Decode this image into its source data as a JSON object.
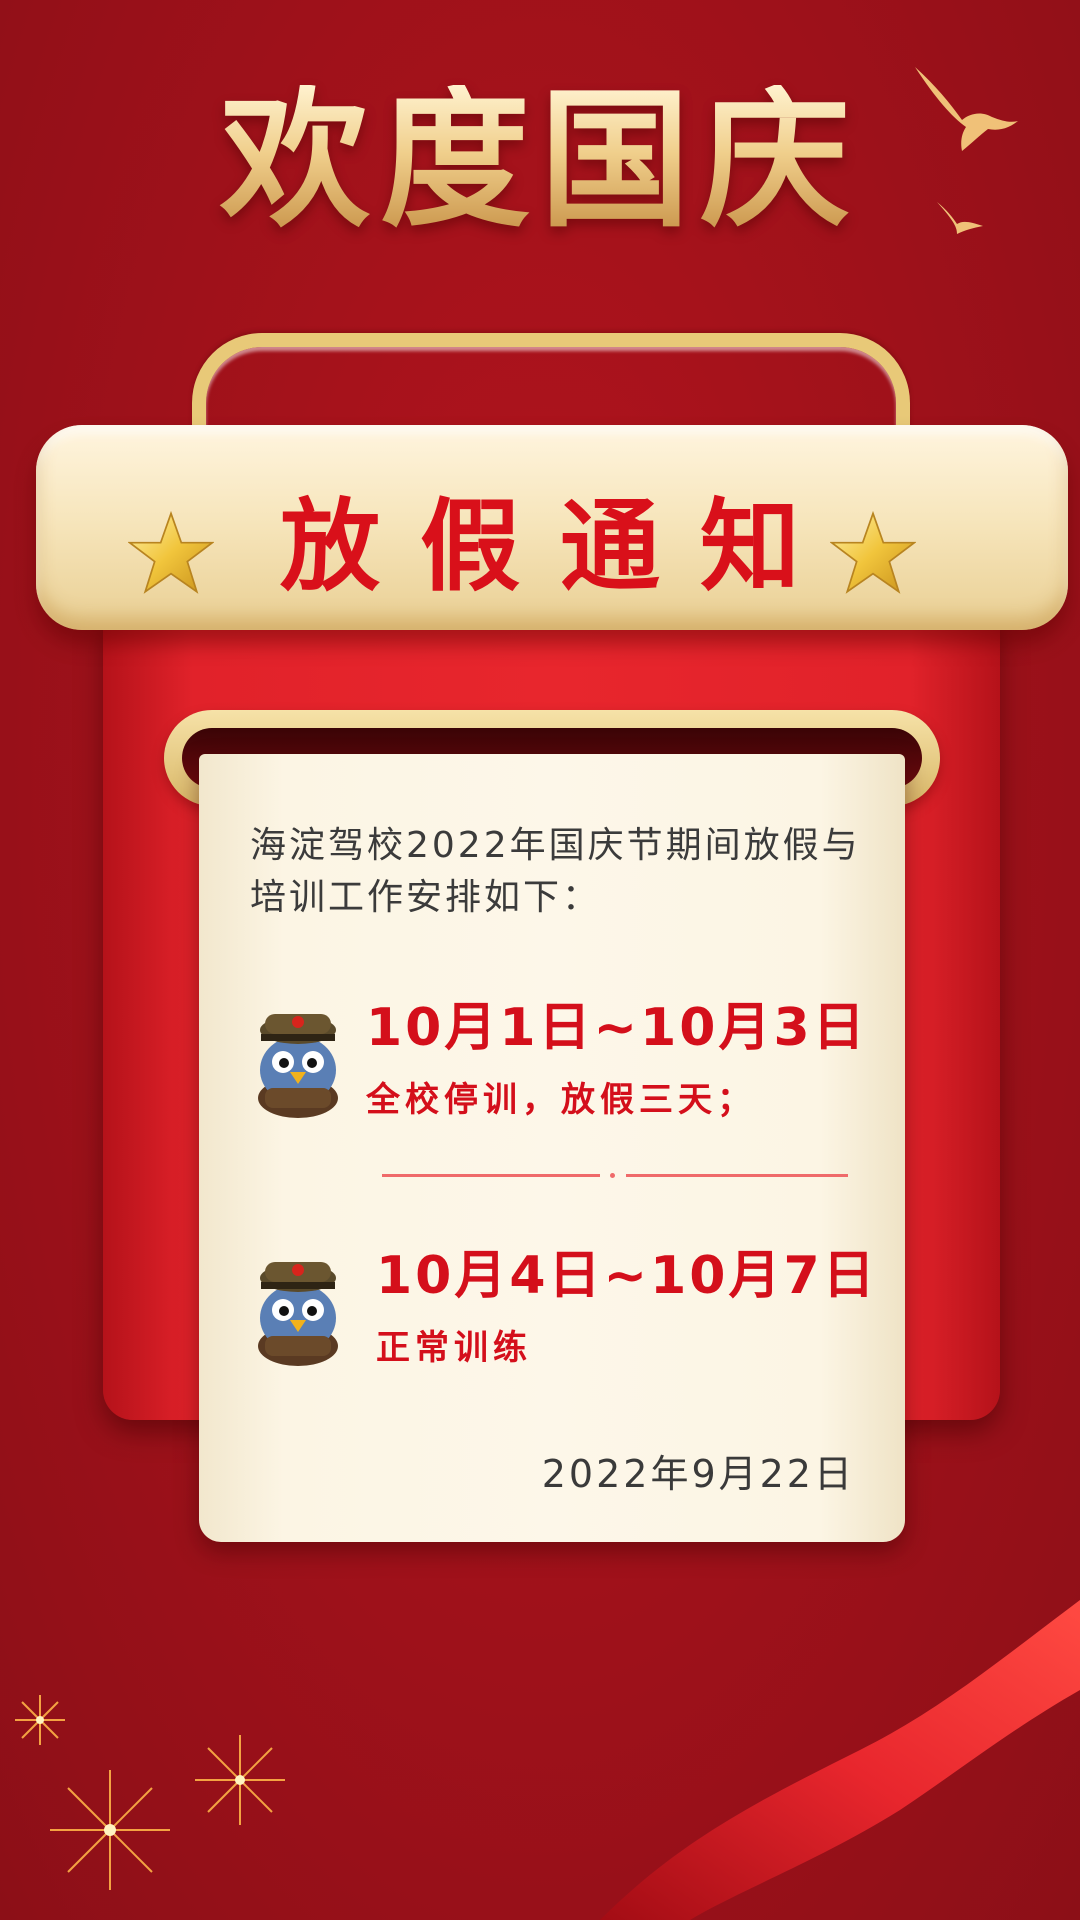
{
  "header": {
    "title": "欢度国庆"
  },
  "mailbox": {
    "lid_title": "放假通知"
  },
  "notice": {
    "intro": "海淀驾校2022年国庆节期间放假与培训工作安排如下：",
    "items": [
      {
        "date_range": "10月1日~10月3日",
        "description": "全校停训，放假三天；"
      },
      {
        "date_range": "10月4日~10月7日",
        "description": "正常训练"
      }
    ],
    "date": "2022年9月22日"
  },
  "decor": {
    "icons": [
      "eagle-icon",
      "star-icon",
      "mascot-icon",
      "fireworks-icon",
      "ribbon-icon"
    ],
    "colors": {
      "background": "#a3121b",
      "gold": "#f0cf8c",
      "accent_red": "#d40f1b",
      "paper": "#fdf7e9"
    }
  }
}
